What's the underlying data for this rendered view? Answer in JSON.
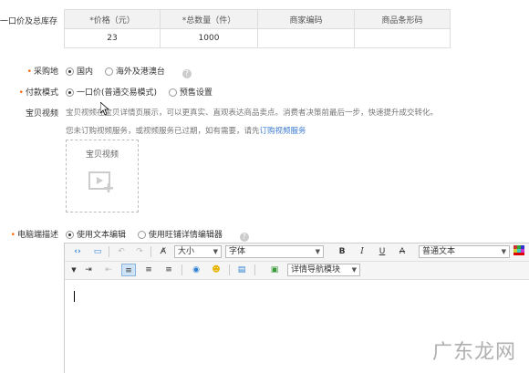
{
  "price_stock": {
    "label": "一口价及总库存",
    "headers": [
      "*价格（元）",
      "*总数量（件）",
      "商家编码",
      "商品条形码"
    ],
    "row": [
      "23",
      "1000",
      "",
      ""
    ]
  },
  "purchase_place": {
    "label": "采购地",
    "options": [
      "国内",
      "海外及港澳台"
    ],
    "selected": "国内"
  },
  "payment_mode": {
    "label": "付款模式",
    "options": [
      "一口价(普通交易模式)",
      "预售设置"
    ],
    "selected": "一口价(普通交易模式)"
  },
  "video": {
    "label": "宝贝视频",
    "desc": "宝贝视频在宝贝详情页展示，可以更真实、直观表达商品卖点。消费者决策前最后一步，快速提升成交转化。",
    "notice": "您未订购视频服务，或视频服务已过期，如有需要，请先",
    "order_link": "订购视频服务",
    "box_title": "宝贝视频"
  },
  "pc_desc": {
    "label": "电脑端描述",
    "options": [
      "使用文本编辑",
      "使用旺铺详情编辑器"
    ],
    "selected": "使用文本编辑"
  },
  "editor": {
    "font_size_label": "大小",
    "font_family_label": "字体",
    "paragraph_label": "普通文本",
    "module_label": "详情导航模块",
    "bold": "B",
    "italic": "I",
    "underline": "U",
    "strike": "A"
  },
  "watermark": "广东龙网",
  "colors": {
    "required": "#ff6600",
    "link": "#3d7ccf",
    "selected_bg": "#cfe3f6"
  }
}
